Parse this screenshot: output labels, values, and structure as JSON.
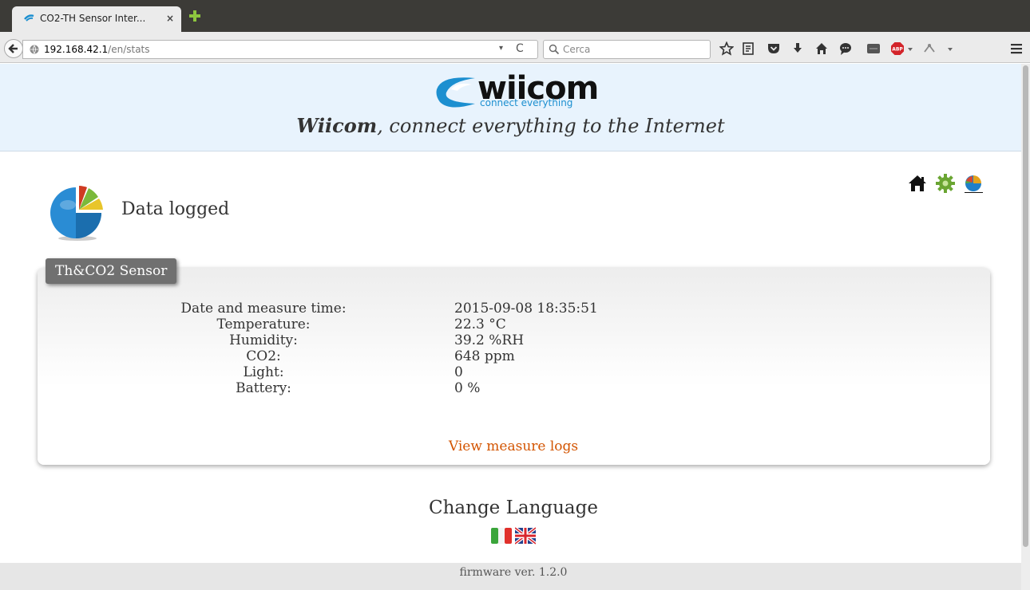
{
  "browser": {
    "tab_title": "CO2-TH Sensor Inter...",
    "tab_close": "×",
    "url_host": "192.168.42.1",
    "url_path": "/en/stats",
    "url_dropdown": "▾",
    "url_reload": "C",
    "search_placeholder": "Cerca",
    "toolbar_icons": [
      "bookmark-star-icon",
      "reading-list-icon",
      "pocket-icon",
      "download-icon",
      "home-icon",
      "chat-icon",
      "extension-icon",
      "adblock-plus-icon",
      "dropdown-icon",
      "addon-icon",
      "dropdown-icon",
      "menu-icon"
    ],
    "adblock_label": "ABP"
  },
  "header": {
    "logo_word": "wiicom",
    "logo_sub": "connect everything",
    "tagline_bold": "Wiicom",
    "tagline_rest": ", connect everything to the Internet"
  },
  "nav_icons": [
    "home-icon",
    "settings-gear-icon",
    "stats-pie-icon"
  ],
  "section": {
    "title": "Data logged"
  },
  "sensor": {
    "badge": "Th&CO2 Sensor",
    "rows": [
      {
        "label": "Date and measure time:",
        "value": "2015-09-08 18:35:51"
      },
      {
        "label": "Temperature:",
        "value": "22.3 °C"
      },
      {
        "label": "Humidity:",
        "value": "39.2 %RH"
      },
      {
        "label": "CO2:",
        "value": "648 ppm"
      },
      {
        "label": "Light:",
        "value": "0"
      },
      {
        "label": "Battery:",
        "value": "0 %"
      }
    ],
    "logs_link": "View measure logs"
  },
  "language": {
    "title": "Change Language",
    "flags": [
      "italian-flag-icon",
      "uk-flag-icon"
    ]
  },
  "footer": {
    "firmware": "firmware ver. 1.2.0"
  },
  "colors": {
    "header_bg": "#e8f3fd",
    "link": "#d35400",
    "badge_bg": "#707070",
    "brand_blue": "#1c8fd0"
  }
}
